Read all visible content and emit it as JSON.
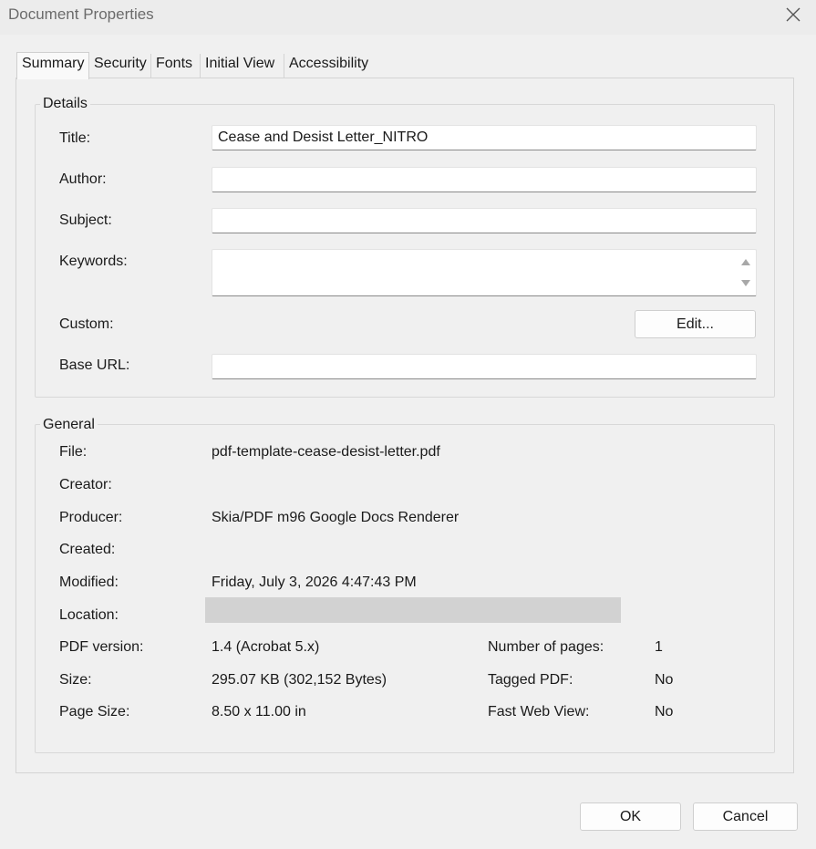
{
  "window": {
    "title": "Document Properties"
  },
  "tabs": [
    {
      "label": "Summary"
    },
    {
      "label": "Security"
    },
    {
      "label": "Fonts"
    },
    {
      "label": "Initial View"
    },
    {
      "label": "Accessibility"
    }
  ],
  "details": {
    "group_label": "Details",
    "title_label": "Title:",
    "title_value": "Cease and Desist Letter_NITRO",
    "author_label": "Author:",
    "author_value": "",
    "subject_label": "Subject:",
    "subject_value": "",
    "keywords_label": "Keywords:",
    "keywords_value": "",
    "custom_label": "Custom:",
    "edit_button": "Edit...",
    "base_url_label": "Base URL:",
    "base_url_value": ""
  },
  "general": {
    "group_label": "General",
    "file_label": "File:",
    "file_value": "pdf-template-cease-desist-letter.pdf",
    "creator_label": "Creator:",
    "creator_value": "",
    "producer_label": "Producer:",
    "producer_value": "Skia/PDF m96 Google Docs Renderer",
    "created_label": "Created:",
    "created_value": "",
    "modified_label": "Modified:",
    "modified_value": "Friday, July 3, 2026 4:47:43 PM",
    "location_label": "Location:",
    "pdf_version_label": "PDF version:",
    "pdf_version_value": "1.4 (Acrobat 5.x)",
    "size_label": "Size:",
    "size_value": "295.07 KB (302,152 Bytes)",
    "page_size_label": "Page Size:",
    "page_size_value": "8.50 x 11.00 in",
    "num_pages_label": "Number of pages:",
    "num_pages_value": "1",
    "tagged_pdf_label": "Tagged PDF:",
    "tagged_pdf_value": "No",
    "fast_web_view_label": "Fast Web View:",
    "fast_web_view_value": "No"
  },
  "buttons": {
    "ok": "OK",
    "cancel": "Cancel"
  }
}
